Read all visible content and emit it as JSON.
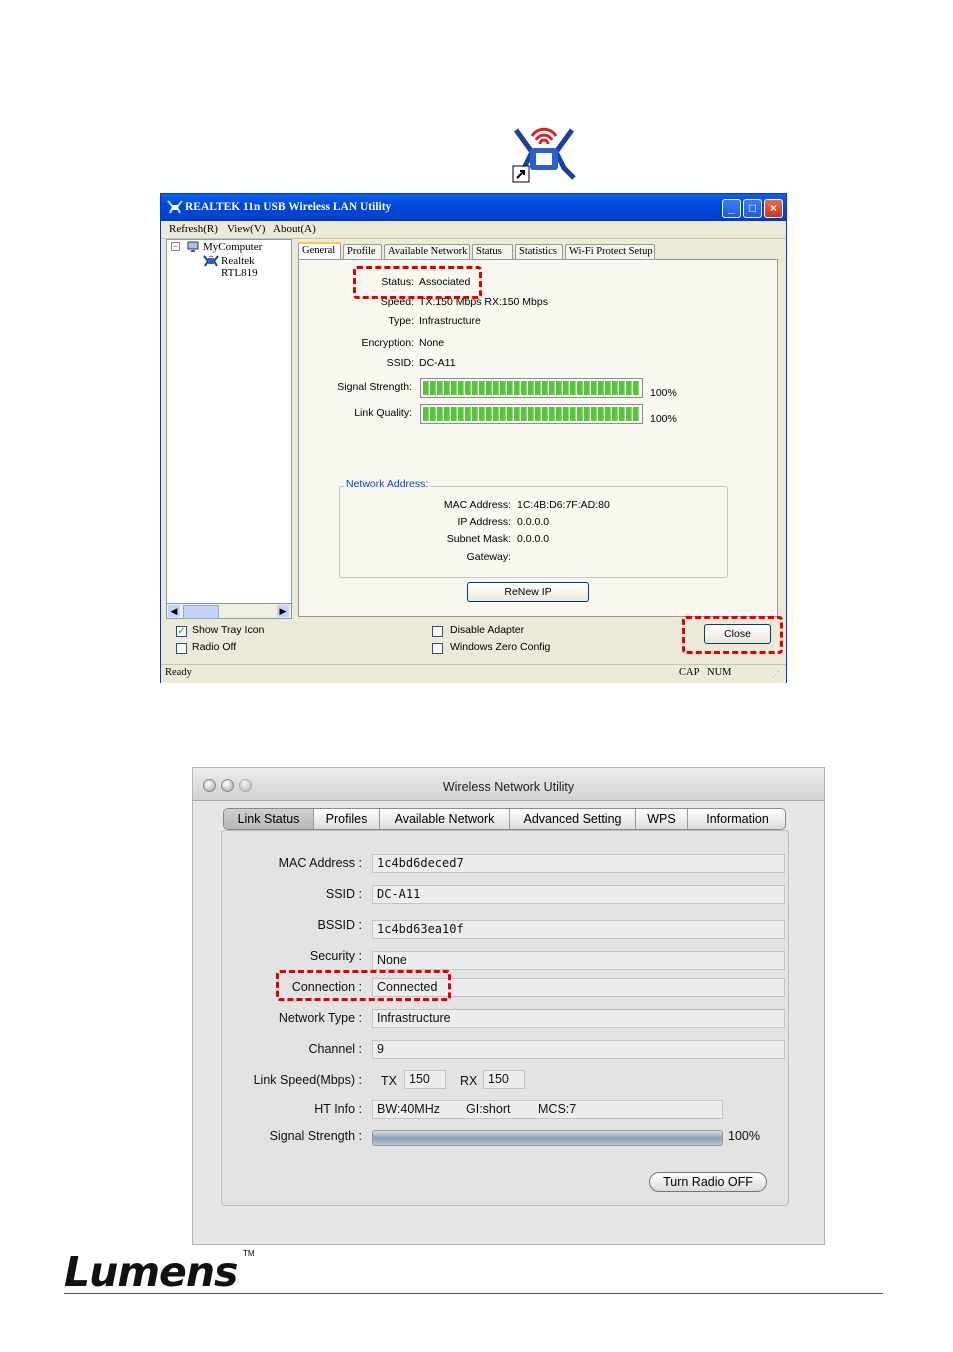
{
  "win": {
    "title": "REALTEK 11n USB Wireless LAN Utility",
    "menu": [
      "Refresh(R)",
      "View(V)",
      "About(A)"
    ],
    "tree": {
      "root": "MyComputer",
      "child": "Realtek RTL819"
    },
    "tabs": [
      "General",
      "Profile",
      "Available Network",
      "Status",
      "Statistics",
      "Wi-Fi Protect Setup"
    ],
    "active_tab": "General",
    "general": {
      "status_label": "Status:",
      "status": "Associated",
      "speed_label": "Speed:",
      "speed": "TX:150 Mbps RX:150 Mbps",
      "type_label": "Type:",
      "type": "Infrastructure",
      "encryption_label": "Encryption:",
      "encryption": "None",
      "ssid_label": "SSID:",
      "ssid": "DC-A11",
      "signal_label": "Signal Strength:",
      "signal_pct": "100%",
      "signal_value": 1.0,
      "quality_label": "Link Quality:",
      "quality_pct": "100%",
      "quality_value": 1.0
    },
    "network_address": {
      "legend": "Network Address:",
      "mac_label": "MAC Address:",
      "mac": "1C:4B:D6:7F:AD:80",
      "ip_label": "IP Address:",
      "ip": "0.0.0.0",
      "subnet_label": "Subnet Mask:",
      "subnet": "0.0.0.0",
      "gateway_label": "Gateway:",
      "gateway": ""
    },
    "renew_label": "ReNew IP",
    "show_tray": "Show Tray Icon",
    "radio_off": "Radio Off",
    "disable_adapter": "Disable Adapter",
    "windows_zero": "Windows Zero Config",
    "close_label": "Close",
    "status_ready": "Ready",
    "status_cap": "CAP",
    "status_num": "NUM"
  },
  "mac": {
    "title": "Wireless Network Utility",
    "tabs": [
      "Link Status",
      "Profiles",
      "Available Network",
      "Advanced Setting",
      "WPS",
      "Information"
    ],
    "active_tab": "Link Status",
    "fields": {
      "mac_label": "MAC Address :",
      "mac": "1c4bd6deced7",
      "ssid_label": "SSID :",
      "ssid": "DC-A11",
      "bssid_label": "BSSID :",
      "bssid": "1c4bd63ea10f",
      "security_label": "Security :",
      "security": "None",
      "connection_label": "Connection :",
      "connection": "Connected",
      "network_type_label": "Network Type :",
      "network_type": "Infrastructure",
      "channel_label": "Channel :",
      "channel": "9",
      "link_speed_label": "Link Speed(Mbps) :",
      "tx_label": "TX",
      "tx": "150",
      "rx_label": "RX",
      "rx": "150",
      "ht_info_label": "HT Info :",
      "ht_bw": "BW:40MHz",
      "ht_gi": "GI:short",
      "ht_mcs": "MCS:7",
      "signal_label": "Signal Strength :",
      "signal_pct": "100%",
      "signal_value": 1.0
    },
    "radio_button": "Turn Radio OFF"
  },
  "footer": {
    "logo": "Lumens",
    "tm": "TM"
  },
  "colors": {
    "highlight": "#e00000",
    "xp_title": "#0048e0",
    "signal_green": "#52c83a"
  }
}
